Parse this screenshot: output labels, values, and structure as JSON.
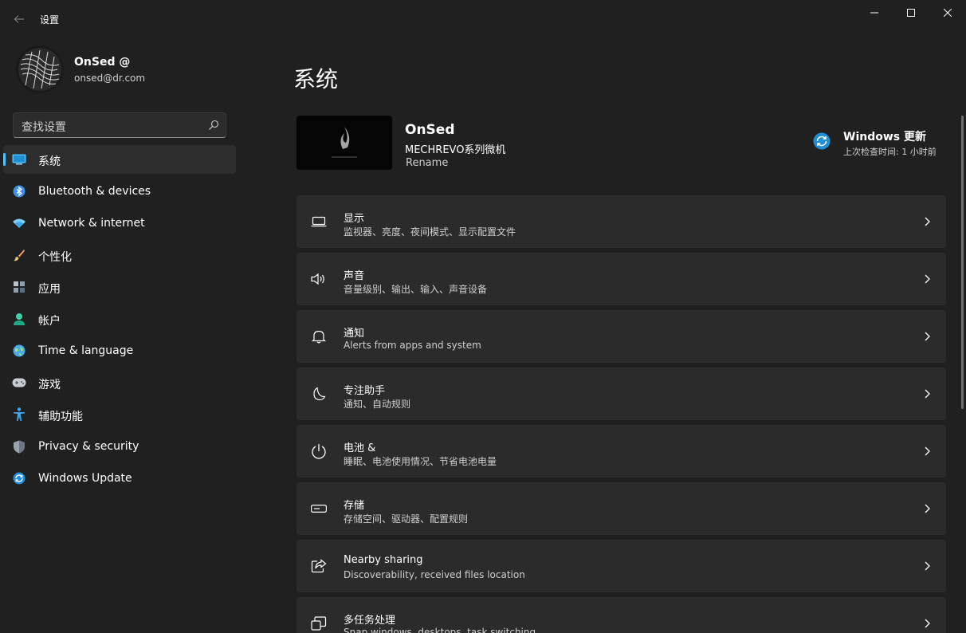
{
  "window": {
    "title": "设置"
  },
  "profile": {
    "name": "OnSed @",
    "email": "onsed@dr.com"
  },
  "search": {
    "placeholder": "查找设置"
  },
  "sidebar": {
    "items": [
      {
        "label": "系统",
        "icon": "monitor-icon",
        "active": true
      },
      {
        "label": "Bluetooth & devices",
        "icon": "bluetooth-icon"
      },
      {
        "label": "Network & internet",
        "icon": "wifi-icon"
      },
      {
        "label": "个性化",
        "icon": "brush-icon"
      },
      {
        "label": "应用",
        "icon": "apps-icon"
      },
      {
        "label": "帐户",
        "icon": "person-icon"
      },
      {
        "label": "Time & language",
        "icon": "globe-icon"
      },
      {
        "label": "游戏",
        "icon": "gamepad-icon"
      },
      {
        "label": "辅助功能",
        "icon": "accessibility-icon"
      },
      {
        "label": "Privacy & security",
        "icon": "shield-icon"
      },
      {
        "label": "Windows Update",
        "icon": "update-icon"
      }
    ]
  },
  "main": {
    "title": "系统",
    "device": {
      "name": "OnSed",
      "model": "MECHREVO系列微机",
      "rename": "Rename"
    },
    "update": {
      "title": "Windows 更新",
      "subtitle": "上次检查时间: 1 小时前"
    },
    "settings": [
      {
        "title": "显示",
        "subtitle": "监视器、亮度、夜间模式、显示配置文件",
        "icon": "display-icon"
      },
      {
        "title": "声音",
        "subtitle": "音量级别、输出、输入、声音设备",
        "icon": "speaker-icon"
      },
      {
        "title": "通知",
        "subtitle": "Alerts from apps and system",
        "icon": "bell-icon"
      },
      {
        "title": "专注助手",
        "subtitle": "通知、自动规则",
        "icon": "moon-icon"
      },
      {
        "title": "电池 &",
        "subtitle": "睡眠、电池使用情况、节省电池电量",
        "icon": "power-icon"
      },
      {
        "title": "存储",
        "subtitle": "存储空间、驱动器、配置规则",
        "icon": "storage-icon"
      },
      {
        "title": "Nearby sharing",
        "subtitle": "Discoverability, received files location",
        "icon": "share-icon"
      },
      {
        "title": "多任务处理",
        "subtitle": "Snap windows, desktops, task switching",
        "icon": "multitask-icon"
      }
    ]
  },
  "colors": {
    "background": "#202020",
    "card": "#2b2b2b",
    "accent": "#4cc2ff"
  }
}
